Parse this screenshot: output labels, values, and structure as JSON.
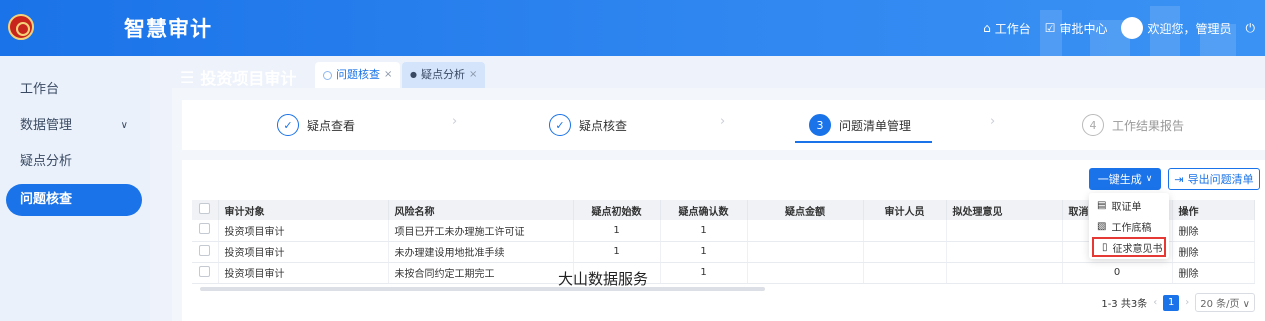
{
  "header": {
    "app_title": "智慧审计",
    "workbench": "工作台",
    "approval": "审批中心",
    "welcome": "欢迎您，管理员"
  },
  "sidebar": {
    "items": [
      {
        "label": "工作台"
      },
      {
        "label": "数据管理"
      },
      {
        "label": "疑点分析"
      },
      {
        "label": "问题核查"
      }
    ]
  },
  "page": {
    "title": "投资项目审计",
    "tabs": [
      {
        "label": "问题核查"
      },
      {
        "label": "疑点分析"
      }
    ]
  },
  "steps": [
    {
      "num": "✓",
      "label": "疑点查看"
    },
    {
      "num": "✓",
      "label": "疑点核查"
    },
    {
      "num": "3",
      "label": "问题清单管理"
    },
    {
      "num": "4",
      "label": "工作结果报告"
    }
  ],
  "toolbar": {
    "generate": "一键生成",
    "export": "导出问题清单"
  },
  "dropdown": {
    "items": [
      "取证单",
      "工作底稿",
      "征求意见书"
    ]
  },
  "table": {
    "headers": [
      "审计对象",
      "风险名称",
      "疑点初始数",
      "疑点确认数",
      "疑点金额",
      "审计人员",
      "拟处理意见",
      "取消",
      "操作"
    ],
    "rows": [
      {
        "target": "投资项目审计",
        "risk": "项目已开工未办理施工许可证",
        "init": "1",
        "confirm": "1",
        "cancel": "",
        "action": "删除"
      },
      {
        "target": "投资项目审计",
        "risk": "未办理建设用地批准手续",
        "init": "1",
        "confirm": "1",
        "cancel": "",
        "action": "删除"
      },
      {
        "target": "投资项目审计",
        "risk": "未按合同约定工期完工",
        "init": "",
        "confirm": "1",
        "cancel": "0",
        "action": "删除"
      }
    ]
  },
  "pagination": {
    "summary": "1-3 共3条",
    "current": "1",
    "page_size": "20 条/页"
  },
  "watermark": "大山数据服务"
}
